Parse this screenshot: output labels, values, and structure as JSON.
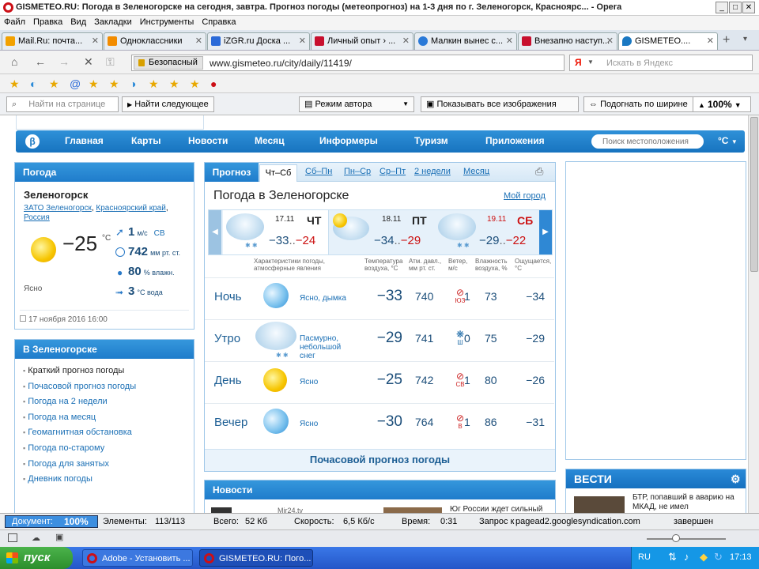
{
  "window": {
    "title": "GISMETEO.RU: Погода в Зеленогорске на сегодня, завтра. Прогноз погоды (метеопрогноз) на 1-3 дня по г. Зеленогорск, Красноярс... - Opera"
  },
  "menu": [
    "Файл",
    "Правка",
    "Вид",
    "Закладки",
    "Инструменты",
    "Справка"
  ],
  "tabs": [
    {
      "label": "Mail.Ru: почта...",
      "icon": "mailru-icon",
      "color": "#f2a100"
    },
    {
      "label": "Одноклассники",
      "icon": "ok-icon",
      "color": "#f28c00"
    },
    {
      "label": "iZGR.ru Доска ...",
      "icon": "izgr-icon",
      "color": "#2a6ad8"
    },
    {
      "label": "Личный опыт › ...",
      "icon": "d-icon",
      "color": "#c8102e"
    },
    {
      "label": "Малкин вынес с...",
      "icon": "globe-icon",
      "color": "#2a7ad8"
    },
    {
      "label": "Внезапно наступ...",
      "icon": "d-icon",
      "color": "#c8102e"
    },
    {
      "label": "GISMETEO....",
      "icon": "drop-icon",
      "color": "#1a78c2"
    }
  ],
  "address": {
    "secure_label": "Безопасный",
    "url": "www.gismeteo.ru/city/daily/11419/",
    "search_engine": "Я",
    "search_placeholder": "Искать в Яндекс"
  },
  "findbar": {
    "placeholder": "Найти на странице",
    "find_next": "Найти следующее",
    "author_mode": "Режим автора",
    "show_images": "Показывать все изображения",
    "fit_width": "Подогнать по ширине",
    "zoom": "100%"
  },
  "nav": {
    "items": [
      "Главная",
      "Карты",
      "Новости",
      "Месяц",
      "Информеры",
      "Туризм",
      "Приложения"
    ],
    "search_placeholder": "Поиск местоположения",
    "unit": "°C"
  },
  "weather_box": {
    "header": "Погода",
    "city": "Зеленогорск",
    "region_links": [
      "ЗАТО Зеленогорск",
      "Красноярский край",
      "Россия"
    ],
    "temp": "−25",
    "temp_unit": "°C",
    "condition": "Ясно",
    "wind": "1",
    "wind_unit": "м/с",
    "wind_dir": "СВ",
    "pressure": "742",
    "pressure_unit": "мм рт. ст.",
    "humidity": "80",
    "humidity_unit": "% влажн.",
    "water": "3",
    "water_unit": "°C вода",
    "updated": "17 ноября 2016 16:00"
  },
  "city_box": {
    "header": "В Зеленогорске",
    "links": [
      "Краткий прогноз погоды",
      "Почасовой прогноз погоды",
      "Погода на 2 недели",
      "Погода на месяц",
      "Геомагнитная обстановка",
      "Погода по-старому",
      "Погода для занятых",
      "Дневник погоды"
    ]
  },
  "forecast": {
    "tab_active": "Прогноз",
    "tabs": [
      "Чт–Сб",
      "Сб–Пн",
      "Пн–Ср",
      "Ср–Пт",
      "2 недели",
      "Месяц"
    ],
    "title": "Погода в Зеленогорске",
    "my_city": "Мой город",
    "days": [
      {
        "date": "17.11",
        "day": "ЧТ",
        "min": "−33",
        "max": "−24",
        "weekend": false
      },
      {
        "date": "18.11",
        "day": "ПТ",
        "min": "−34",
        "max": "−29",
        "weekend": false
      },
      {
        "date": "19.11",
        "day": "СБ",
        "min": "−29",
        "max": "−22",
        "weekend": true
      }
    ],
    "col_headers": {
      "cond": "Характеристики погоды, атмосферные явления",
      "temp": "Температура воздуха, °C",
      "pres": "Атм. давл., мм рт. ст.",
      "wind": "Ветер, м/с",
      "hum": "Влажность воздуха, %",
      "feel": "Ощущается, °C"
    },
    "rows": [
      {
        "period": "Ночь",
        "icon": "moon-icon",
        "condition": "Ясно, дымка",
        "temp": "−33",
        "pressure": "740",
        "wind_dir": "ЮЗ",
        "wind": "1",
        "humidity": "73",
        "feels": "−34"
      },
      {
        "period": "Утро",
        "icon": "snow-cloud-icon",
        "condition": "Пасмурно, небольшой снег",
        "temp": "−29",
        "pressure": "741",
        "wind_dir": "Ш",
        "wind": "0",
        "humidity": "75",
        "feels": "−29"
      },
      {
        "period": "День",
        "icon": "sun-icon",
        "condition": "Ясно",
        "temp": "−25",
        "pressure": "742",
        "wind_dir": "СВ",
        "wind": "1",
        "humidity": "80",
        "feels": "−26"
      },
      {
        "period": "Вечер",
        "icon": "moon-icon",
        "condition": "Ясно",
        "temp": "−30",
        "pressure": "764",
        "wind_dir": "В",
        "wind": "1",
        "humidity": "86",
        "feels": "−31"
      }
    ],
    "hourly_link": "Почасовой прогноз погоды"
  },
  "news": {
    "header": "Новости",
    "item1": "Mir24.tv",
    "item2": "Юг России ждет сильный"
  },
  "vesti": {
    "header": "ВЕСТИ",
    "text": "БТР, попавший в аварию на МКАД, не имел"
  },
  "status": {
    "doc_label": "Документ:",
    "doc_value": "100%",
    "elements_label": "Элементы:",
    "elements_value": "113/113",
    "total_label": "Всего:",
    "total_value": "52 Кб",
    "speed_label": "Скорость:",
    "speed_value": "6,5 Кб/с",
    "time_label": "Время:",
    "time_value": "0:31",
    "request_label": "Запрос к",
    "request_host": "pagead2.googlesyndication.com",
    "request_state": "завершен"
  },
  "taskbar": {
    "start": "пуск",
    "buttons": [
      "Adobe - Установить ...",
      "GISMETEO.RU: Погo..."
    ],
    "lang": "RU",
    "clock": "17:13"
  }
}
